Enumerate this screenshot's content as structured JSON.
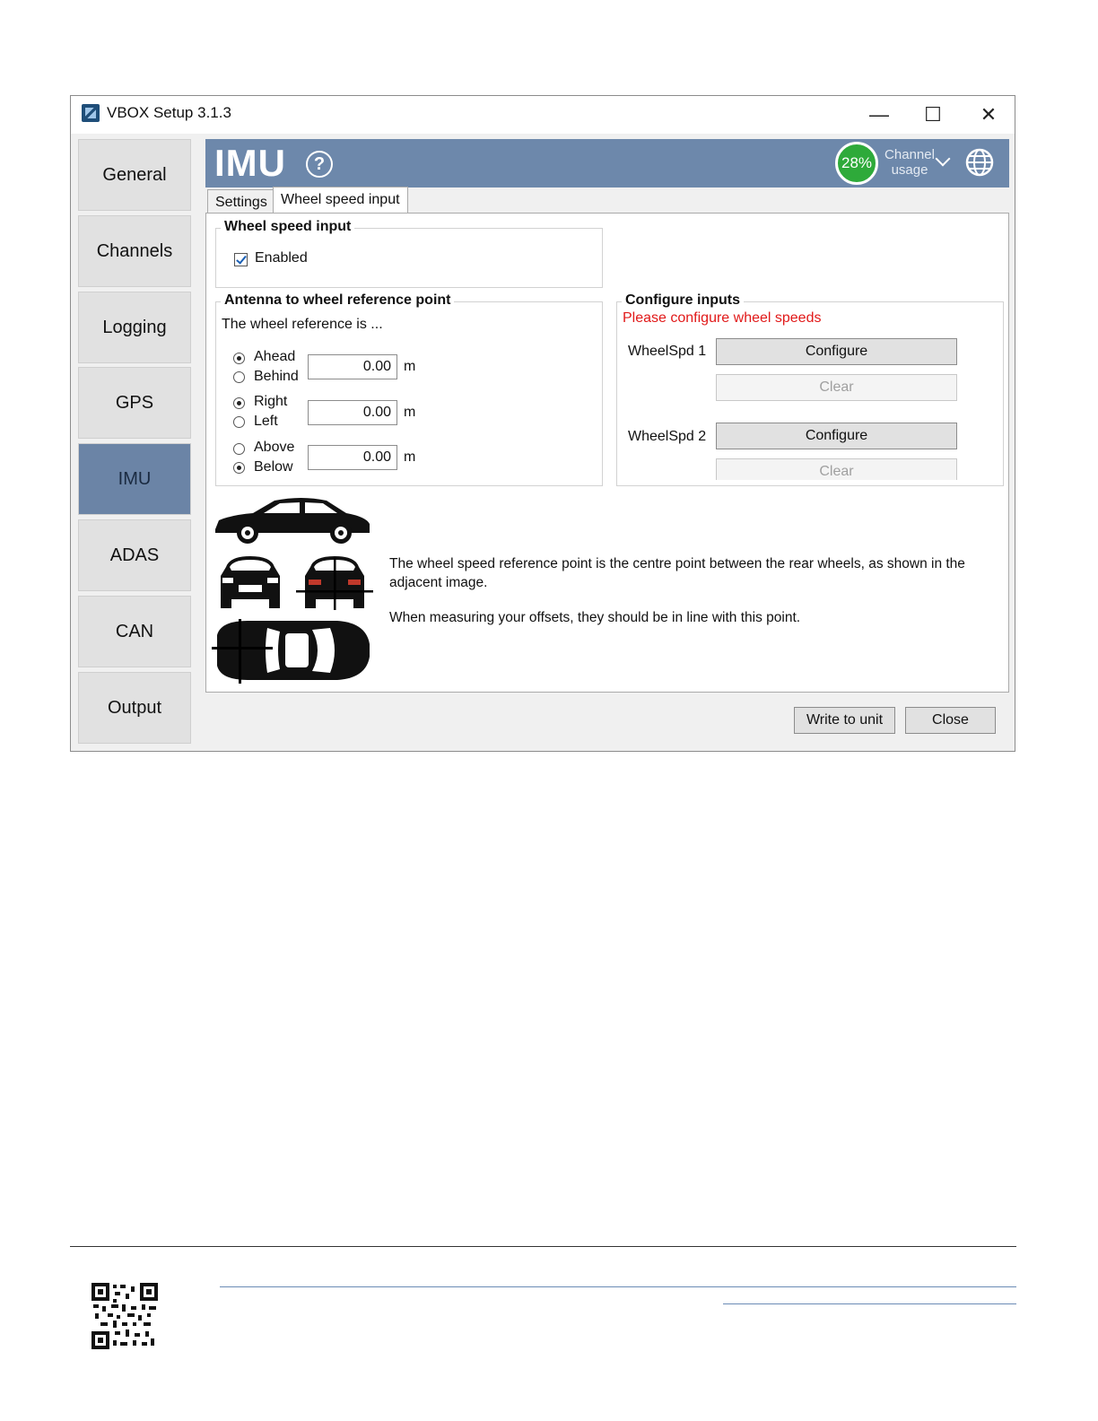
{
  "window": {
    "title": "VBOX Setup 3.1.3",
    "controls": {
      "minimize": "—",
      "maximize": "☐",
      "close": "✕"
    }
  },
  "sidebar": {
    "items": [
      {
        "label": "General"
      },
      {
        "label": "Channels"
      },
      {
        "label": "Logging"
      },
      {
        "label": "GPS"
      },
      {
        "label": "IMU",
        "active": true
      },
      {
        "label": "ADAS"
      },
      {
        "label": "CAN"
      },
      {
        "label": "Output"
      }
    ]
  },
  "header": {
    "title": "IMU",
    "help_glyph": "?",
    "channel_usage_percent": "28%",
    "channel_usage_label_1": "Channel",
    "channel_usage_label_2": "usage",
    "colors": {
      "header_bg": "#6d88ab",
      "usage_circle": "#2eaa3a"
    }
  },
  "tabs": [
    {
      "label": "Settings"
    },
    {
      "label": "Wheel speed input",
      "active": true
    }
  ],
  "wheel_speed_input": {
    "group_title": "Wheel speed input",
    "enabled_label": "Enabled",
    "enabled": true
  },
  "antenna": {
    "group_title": "Antenna to wheel reference point",
    "intro": "The wheel reference is ...",
    "rows": [
      {
        "option_a": "Ahead",
        "option_b": "Behind",
        "selected": "a",
        "value": "0.00",
        "unit": "m"
      },
      {
        "option_a": "Right",
        "option_b": "Left",
        "selected": "a",
        "value": "0.00",
        "unit": "m"
      },
      {
        "option_a": "Above",
        "option_b": "Below",
        "selected": "b",
        "value": "0.00",
        "unit": "m"
      }
    ]
  },
  "configure_inputs": {
    "group_title": "Configure inputs",
    "warning": "Please configure wheel speeds",
    "warning_color": "#e11919",
    "wheels": [
      {
        "label": "WheelSpd 1",
        "configure": "Configure",
        "clear": "Clear"
      },
      {
        "label": "WheelSpd 2",
        "configure": "Configure",
        "clear": "Clear"
      }
    ]
  },
  "description": {
    "line1": "The wheel speed reference point is the centre point between the rear wheels, as shown in the adjacent image.",
    "line2": "When measuring your offsets, they should be in line with this point."
  },
  "footer_buttons": {
    "write": "Write to unit",
    "close": "Close"
  },
  "icons": {
    "app": "vbox-app-icon",
    "help": "question-circle-icon",
    "globe": "globe-icon",
    "chevron": "chevron-down-icon",
    "qr": "qr-code-icon"
  }
}
